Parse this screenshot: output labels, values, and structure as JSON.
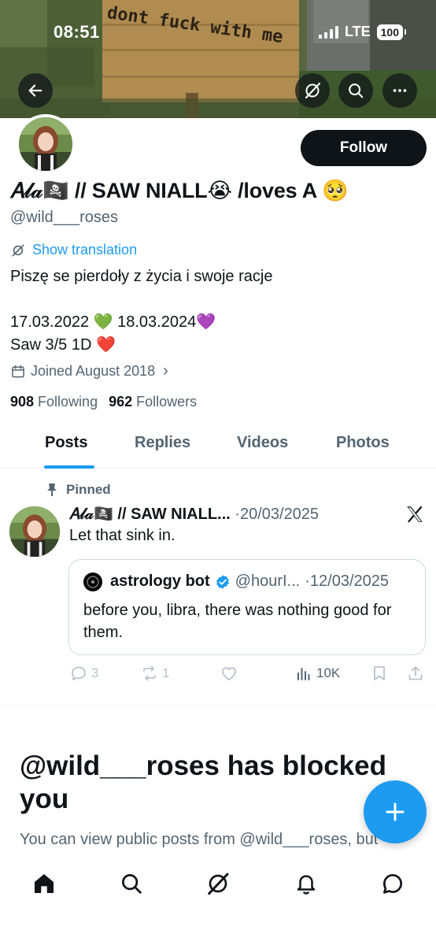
{
  "status_bar": {
    "time": "08:51",
    "network": "LTE",
    "battery": "100"
  },
  "banner": {
    "sign_text": "dont fuck with me"
  },
  "profile": {
    "display_name": "𝐴𝓁𝒶🏴‍☠️ // SAW NIALL😭 /loves A 🥺",
    "handle": "@wild___roses",
    "follow_label": "Follow",
    "show_translation": "Show translation",
    "bio": "Piszę se pierdoły z życia i swoje racje\n\n17.03.2022 💚 18.03.2024💜\nSaw 3/5 1D ❤️",
    "joined": "Joined August 2018",
    "following_count": "908",
    "following_label": "Following",
    "followers_count": "962",
    "followers_label": "Followers"
  },
  "tabs": [
    {
      "label": "Posts",
      "active": true
    },
    {
      "label": "Replies",
      "active": false
    },
    {
      "label": "Videos",
      "active": false
    },
    {
      "label": "Photos",
      "active": false
    }
  ],
  "pinned_post": {
    "pinned_label": "Pinned",
    "author_name": "𝐴𝓁𝒶🏴‍☠️ // SAW NIALL...",
    "date": "·20/03/2025",
    "text": "Let that sink in.",
    "quote": {
      "author_name": "astrology bot",
      "handle": "@hourI...",
      "date": "·12/03/2025",
      "text": "before you, libra, there was nothing good for them."
    },
    "replies": "3",
    "reposts": "1",
    "views": "10K"
  },
  "blocked": {
    "title": "@wild___roses has blocked you",
    "subtitle": "You can view public posts from @wild___roses, but"
  },
  "colors": {
    "accent": "#1d9bf0",
    "text": "#0f1419",
    "muted": "#536471"
  },
  "icons": [
    "back-arrow-icon",
    "grok-icon",
    "search-icon",
    "more-icon",
    "translate-icon",
    "calendar-icon",
    "pin-icon",
    "x-logo-icon",
    "verified-icon",
    "reply-icon",
    "repost-icon",
    "like-icon",
    "views-icon",
    "bookmark-icon",
    "share-icon",
    "plus-icon",
    "home-icon",
    "notifications-icon",
    "messages-icon"
  ]
}
